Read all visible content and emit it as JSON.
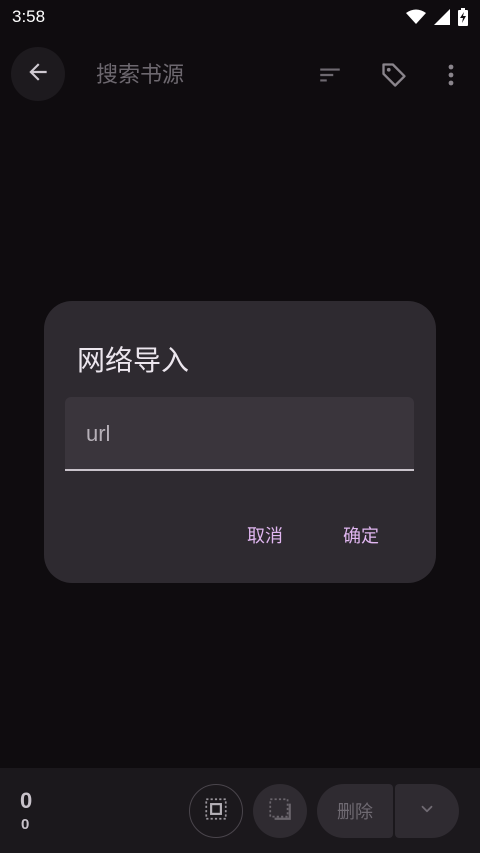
{
  "status_bar": {
    "time": "3:58",
    "icons": [
      "wifi-icon",
      "signal-icon",
      "battery-charging-icon"
    ]
  },
  "toolbar": {
    "back_icon": "arrow-back-icon",
    "search_placeholder": "搜索书源",
    "actions": [
      "sort-icon",
      "tag-icon",
      "more-vert-icon"
    ]
  },
  "dialog": {
    "title": "网络导入",
    "url_placeholder": "url",
    "url_value": "",
    "cancel_label": "取消",
    "confirm_label": "确定"
  },
  "bottom_bar": {
    "selected_count": "0",
    "total_count": "0",
    "select_all_icon": "select-all-icon",
    "select_invert_icon": "select-invert-icon",
    "delete_label": "删除",
    "menu_icon": "chevron-down-icon"
  },
  "colors": {
    "accent": "#e0b6f0",
    "dialog_bg": "#2e2a30",
    "page_bg": "#0f0c0f"
  }
}
